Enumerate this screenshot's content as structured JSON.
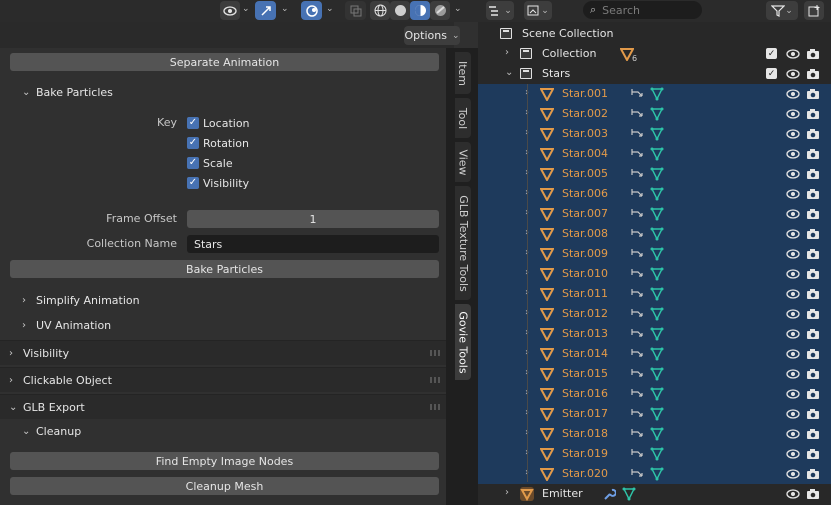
{
  "viewport_header": {
    "options_label": "Options"
  },
  "sidebar": {
    "separate_animation_label": "Separate Animation",
    "bake_particles_header": "Bake Particles",
    "key_label": "Key",
    "checks": [
      {
        "label": "Location",
        "checked": true
      },
      {
        "label": "Rotation",
        "checked": true
      },
      {
        "label": "Scale",
        "checked": true
      },
      {
        "label": "Visibility",
        "checked": true
      }
    ],
    "frame_offset_label": "Frame Offset",
    "frame_offset_value": "1",
    "collection_name_label": "Collection Name",
    "collection_name_value": "Stars",
    "bake_particles_button": "Bake Particles",
    "simplify_animation_header": "Simplify Animation",
    "uv_animation_header": "UV Animation",
    "visibility_panel": "Visibility",
    "clickable_object_panel": "Clickable Object",
    "glb_export_panel": "GLB Export",
    "cleanup_header": "Cleanup",
    "find_empty_label": "Find Empty Image Nodes",
    "cleanup_mesh_label": "Cleanup Mesh"
  },
  "tabs": [
    "Item",
    "Tool",
    "View",
    "GLB Texture Tools",
    "Govie Tools"
  ],
  "outliner": {
    "search_placeholder": "Search",
    "scene_collection": "Scene Collection",
    "collection": {
      "name": "Collection",
      "count": "6"
    },
    "stars": {
      "name": "Stars"
    },
    "star_items": [
      "Star.001",
      "Star.002",
      "Star.003",
      "Star.004",
      "Star.005",
      "Star.006",
      "Star.007",
      "Star.008",
      "Star.009",
      "Star.010",
      "Star.011",
      "Star.012",
      "Star.013",
      "Star.014",
      "Star.015",
      "Star.016",
      "Star.017",
      "Star.018",
      "Star.019",
      "Star.020"
    ],
    "emitter": {
      "name": "Emitter"
    }
  },
  "colors": {
    "accent": "#4772b3",
    "selection": "#1e3a5c",
    "object_orange": "#e29a4a",
    "mesh_teal": "#2ec4a8"
  }
}
